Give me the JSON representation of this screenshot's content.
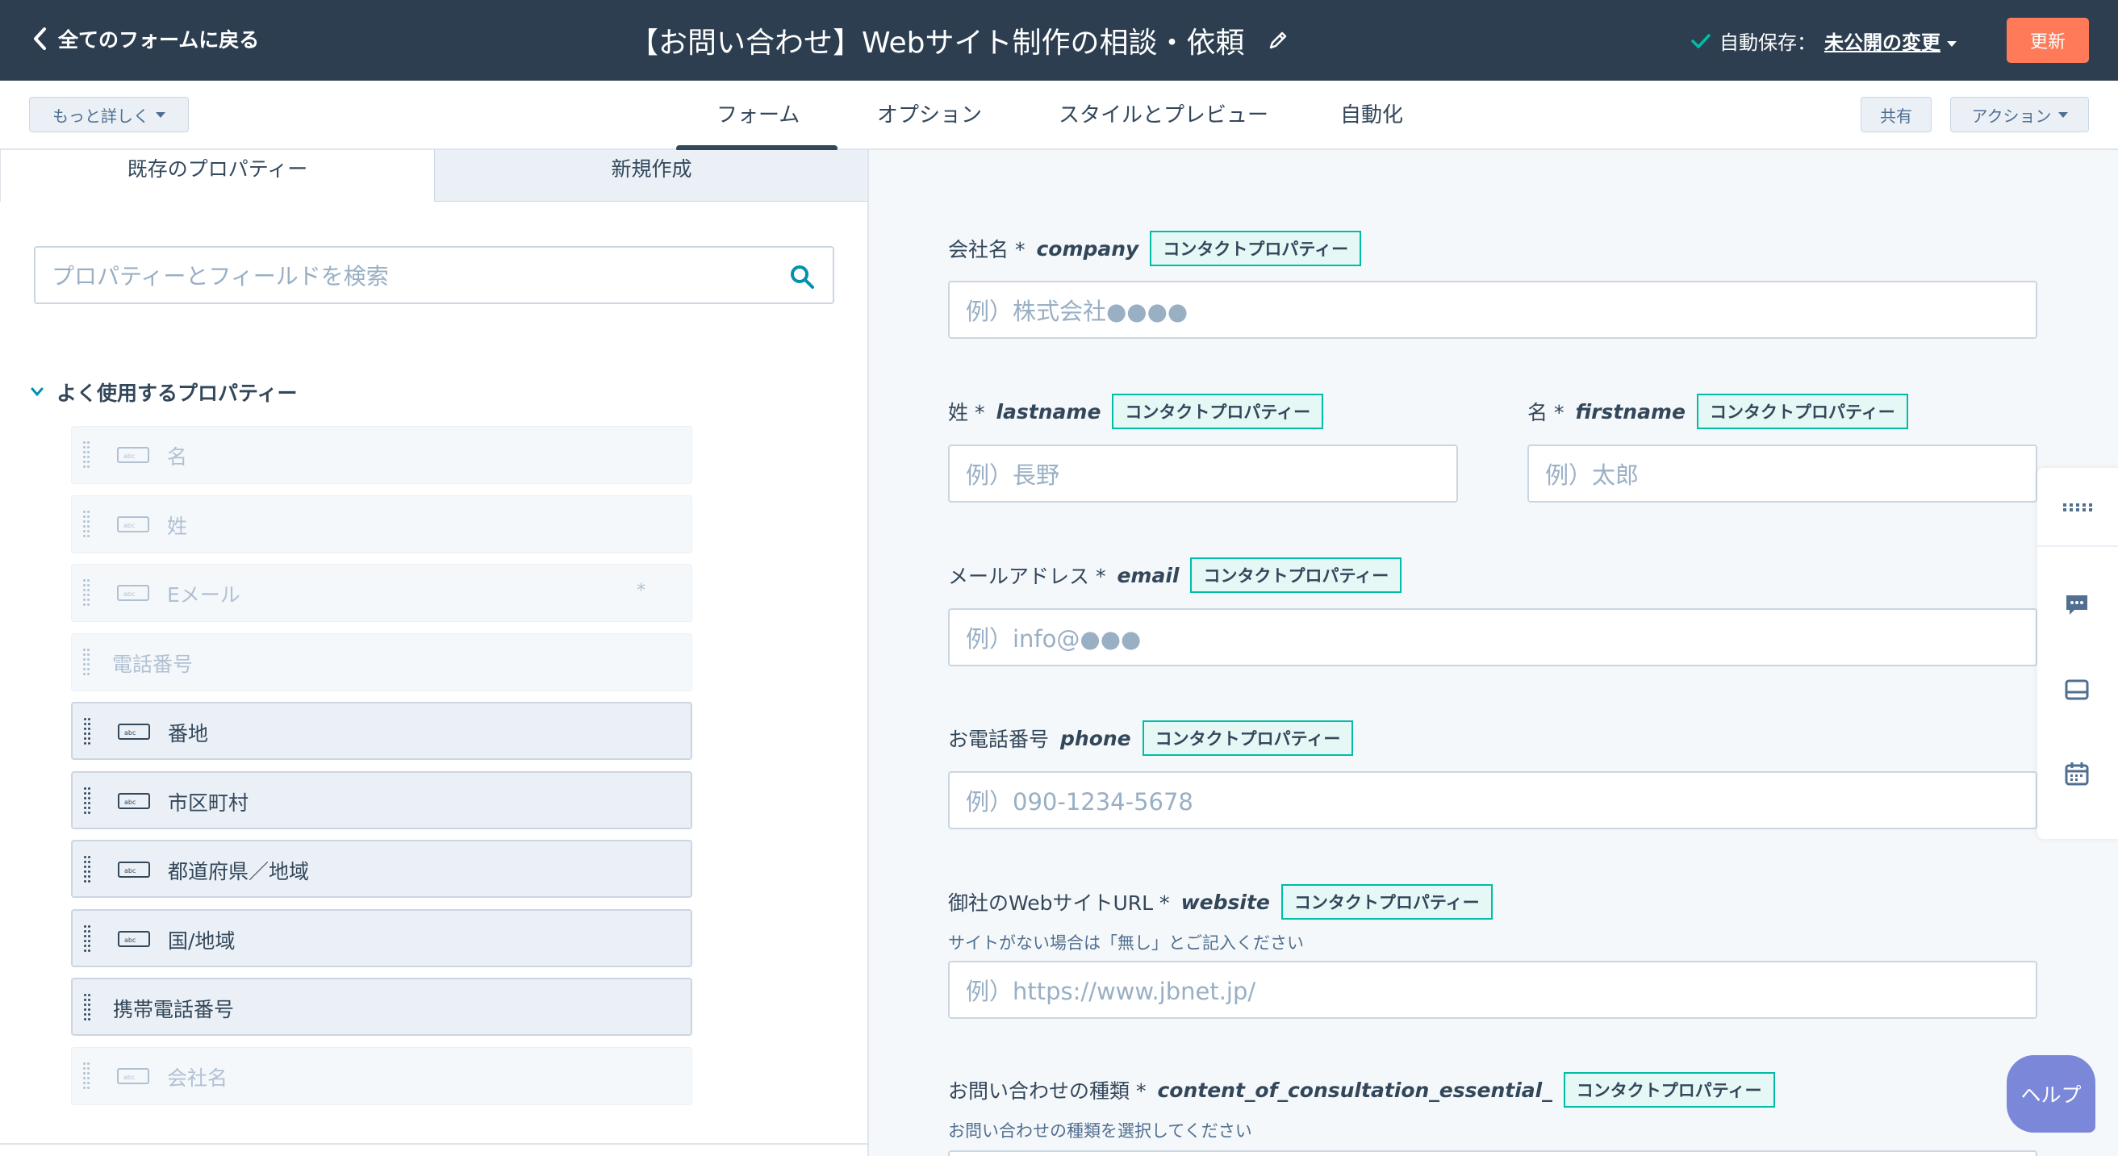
{
  "topbar": {
    "back_label": "全てのフォームに戻る",
    "form_title": "【お問い合わせ】Webサイト制作の相談・依頼",
    "autosave_label": "自動保存：",
    "autosave_link": "未公開の変更",
    "update_label": "更新"
  },
  "tabbar": {
    "more_label": "もっと詳しく",
    "tabs": [
      {
        "label": "フォーム",
        "active": true
      },
      {
        "label": "オプション"
      },
      {
        "label": "スタイルとプレビュー"
      },
      {
        "label": "自動化"
      }
    ],
    "share_label": "共有",
    "actions_label": "アクション"
  },
  "left": {
    "tabs": [
      "既存のプロパティー",
      "新規作成"
    ],
    "search_placeholder": "プロパティーとフィールドを検索",
    "section_title": "よく使用するプロパティー",
    "properties": [
      {
        "label": "名",
        "enabled": false,
        "icon": true
      },
      {
        "label": "姓",
        "enabled": false,
        "icon": true
      },
      {
        "label": "Eメール",
        "enabled": false,
        "icon": true,
        "required": "*"
      },
      {
        "label": "電話番号",
        "enabled": false,
        "icon": false
      },
      {
        "label": "番地",
        "enabled": true,
        "icon": true
      },
      {
        "label": "市区町村",
        "enabled": true,
        "icon": true
      },
      {
        "label": "都道府県／地域",
        "enabled": true,
        "icon": true
      },
      {
        "label": "国/地域",
        "enabled": true,
        "icon": true
      },
      {
        "label": "携帯電話番号",
        "enabled": true,
        "icon": false
      },
      {
        "label": "会社名",
        "enabled": false,
        "icon": true
      }
    ]
  },
  "form": {
    "badge_label": "コンタクトプロパティー",
    "fields": {
      "company": {
        "label": "会社名 *",
        "internal": "company",
        "placeholder": "例）株式会社●●●●"
      },
      "lastname": {
        "label": "姓 *",
        "internal": "lastname",
        "placeholder": "例）長野"
      },
      "firstname": {
        "label": "名 *",
        "internal": "firstname",
        "placeholder": "例）太郎"
      },
      "email": {
        "label": "メールアドレス *",
        "internal": "email",
        "placeholder": "例）info@●●●"
      },
      "phone": {
        "label": "お電話番号",
        "internal": "phone",
        "placeholder": "例）090-1234-5678"
      },
      "website": {
        "label": "御社のWebサイトURL *",
        "internal": "website",
        "help": "サイトがない場合は「無し」とご記入ください",
        "placeholder": "例）https://www.jbnet.jp/"
      },
      "consult": {
        "label": "お問い合わせの種類 *",
        "internal": "content_of_consultation_essential_",
        "help": "お問い合わせの種類を選択してください"
      }
    }
  },
  "help_button_label": "ヘルプ",
  "colors": {
    "topbar": "#2d3e50",
    "update": "#ff7a59",
    "badge_border": "#00bda5",
    "help": "#7b88d9"
  }
}
